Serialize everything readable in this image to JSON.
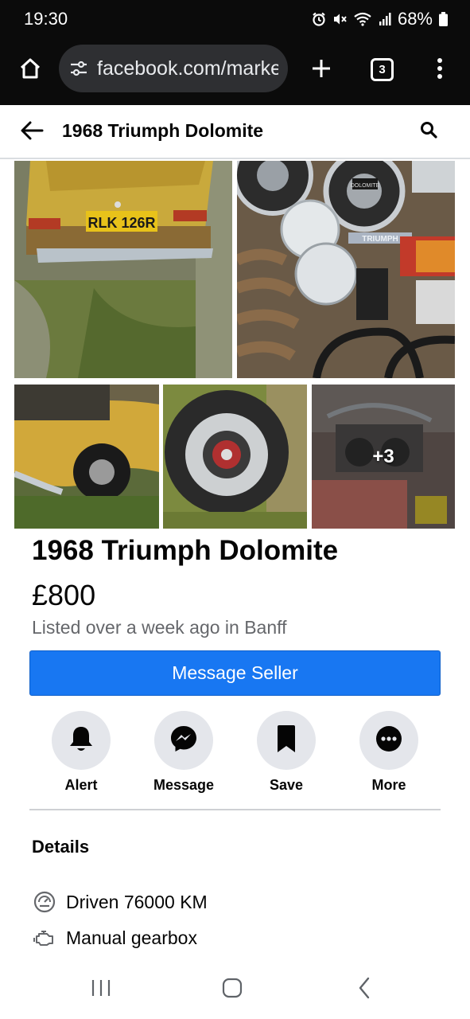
{
  "status_bar": {
    "time": "19:30",
    "battery": "68%",
    "icons": [
      "alarm-icon",
      "mute-icon",
      "wifi-icon",
      "signal-icon",
      "battery-icon"
    ]
  },
  "browser": {
    "url": "facebook.com/marke",
    "tab_count": "3",
    "icons": [
      "home-icon",
      "site-settings-icon",
      "new-tab-icon",
      "kebab-menu-icon"
    ]
  },
  "header": {
    "title": "1968 Triumph Dolomite",
    "icons": [
      "back-arrow-icon",
      "search-icon"
    ]
  },
  "photos": {
    "items": [
      {
        "name": "car-rear-photo",
        "plate": "RLK 126R"
      },
      {
        "name": "parts-photo",
        "badge": "TRIUMPH",
        "hubcap_badge": "DOLOMITE"
      },
      {
        "name": "car-side-photo"
      },
      {
        "name": "wheel-photo"
      },
      {
        "name": "engine-photo",
        "overlay": "+3"
      }
    ]
  },
  "listing": {
    "title": "1968 Triumph Dolomite",
    "price": "£800",
    "meta": "Listed over a week ago in Banff"
  },
  "cta": {
    "label": "Message Seller",
    "color": "#1877f2"
  },
  "actions": [
    {
      "label": "Alert",
      "icon": "bell-icon"
    },
    {
      "label": "Message",
      "icon": "messenger-icon"
    },
    {
      "label": "Save",
      "icon": "bookmark-icon"
    },
    {
      "label": "More",
      "icon": "more-icon"
    }
  ],
  "details": {
    "heading": "Details",
    "items": [
      {
        "text": "Driven 76000 KM",
        "icon": "odometer-icon"
      },
      {
        "text": "Manual gearbox",
        "icon": "engine-icon"
      }
    ]
  },
  "nav": {
    "icons": [
      "recents-icon",
      "home-nav-icon",
      "back-nav-icon"
    ]
  }
}
